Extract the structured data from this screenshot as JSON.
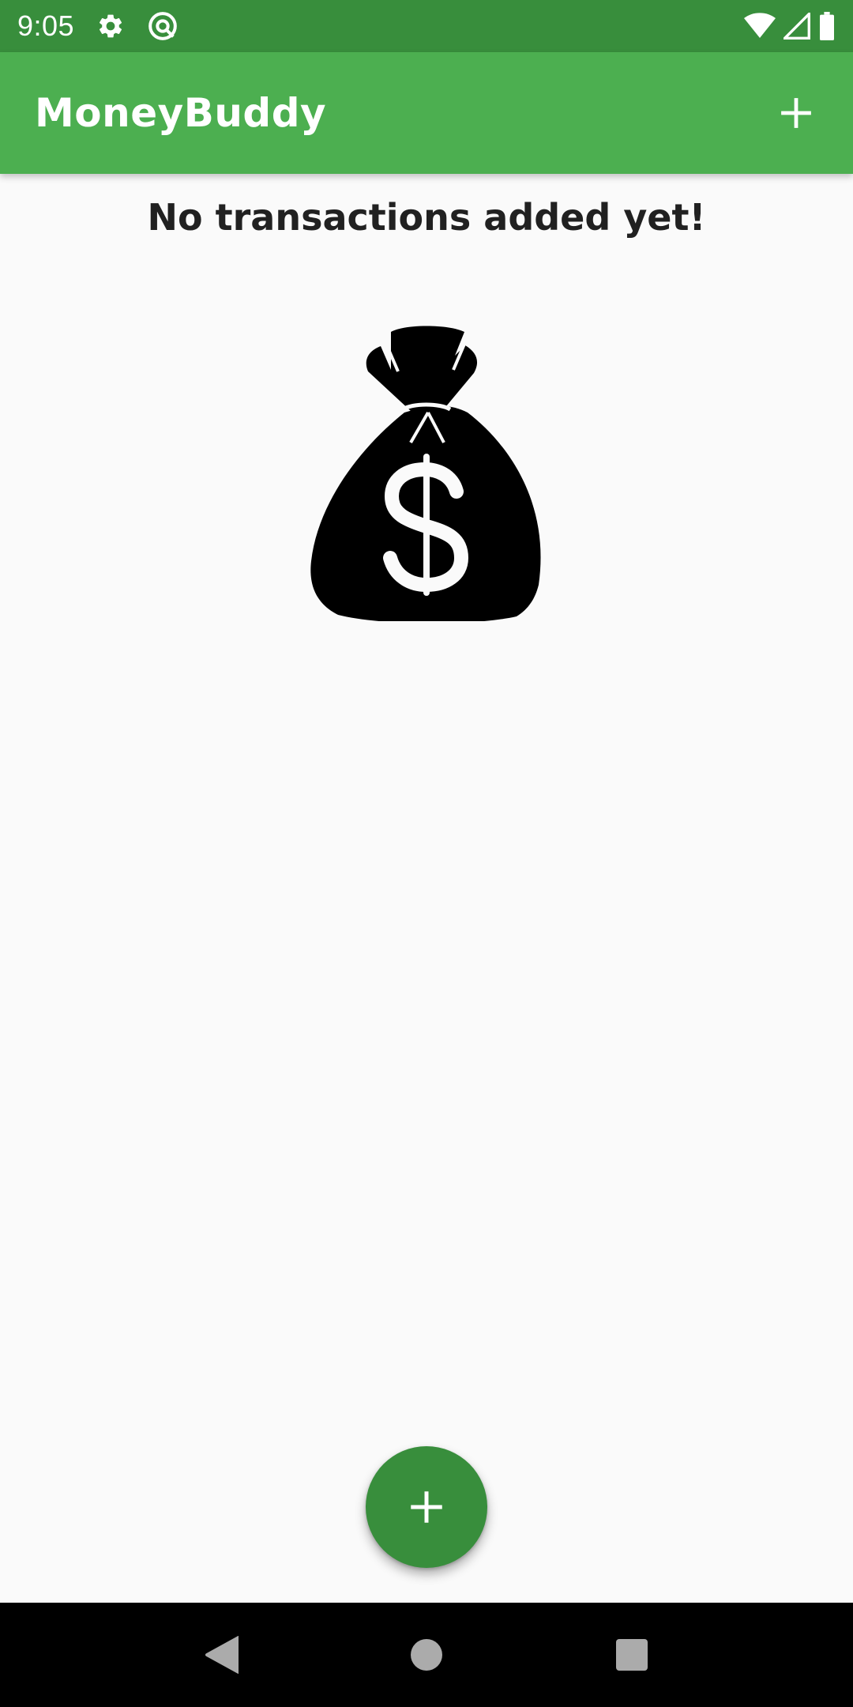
{
  "status_bar": {
    "time": "9:05",
    "icons_left": [
      "settings-icon",
      "at-sign-icon"
    ],
    "icons_right": [
      "wifi-icon",
      "cellular-signal-icon",
      "battery-icon"
    ]
  },
  "app_bar": {
    "title": "MoneyBuddy",
    "action_icon": "add-icon"
  },
  "main": {
    "empty_message": "No transactions added yet!",
    "illustration": "money-bag-icon"
  },
  "fab": {
    "icon": "add-icon"
  },
  "nav_bar": {
    "buttons": [
      "back-icon",
      "home-icon",
      "recents-icon"
    ]
  },
  "colors": {
    "status_bar": "#388e3c",
    "app_bar": "#4caf50",
    "fab": "#388e3c",
    "background": "#fafafa",
    "text": "#212121"
  }
}
